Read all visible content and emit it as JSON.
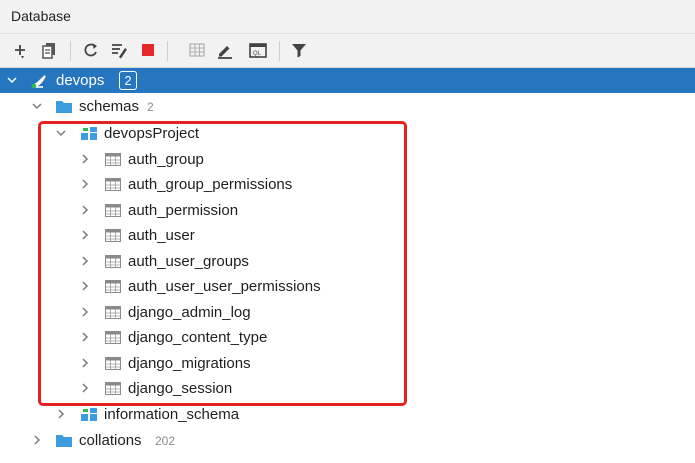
{
  "panel": {
    "title": "Database"
  },
  "toolbar": {
    "buttons": [
      {
        "icon": "add-icon"
      },
      {
        "icon": "properties-icon"
      },
      {
        "icon": "refresh-icon"
      },
      {
        "icon": "sync-schema-icon"
      },
      {
        "icon": "stop-icon"
      },
      {
        "icon": "table-view-icon"
      },
      {
        "icon": "edit-icon"
      },
      {
        "icon": "sql-console-icon"
      },
      {
        "icon": "filter-icon"
      }
    ]
  },
  "tree": {
    "connection": {
      "label": "devops",
      "badge": "2"
    },
    "schemas": {
      "label": "schemas",
      "count": "2"
    },
    "project": {
      "label": "devopsProject"
    },
    "tables": [
      "auth_group",
      "auth_group_permissions",
      "auth_permission",
      "auth_user",
      "auth_user_groups",
      "auth_user_user_permissions",
      "django_admin_log",
      "django_content_type",
      "django_migrations",
      "django_session"
    ],
    "information_schema": {
      "label": "information_schema"
    },
    "collations": {
      "label": "collations",
      "count": "202"
    }
  },
  "colors": {
    "selection": "#2675bf",
    "highlight_border": "#e52222",
    "folder": "#3d9be0",
    "stop": "#e5262b"
  }
}
